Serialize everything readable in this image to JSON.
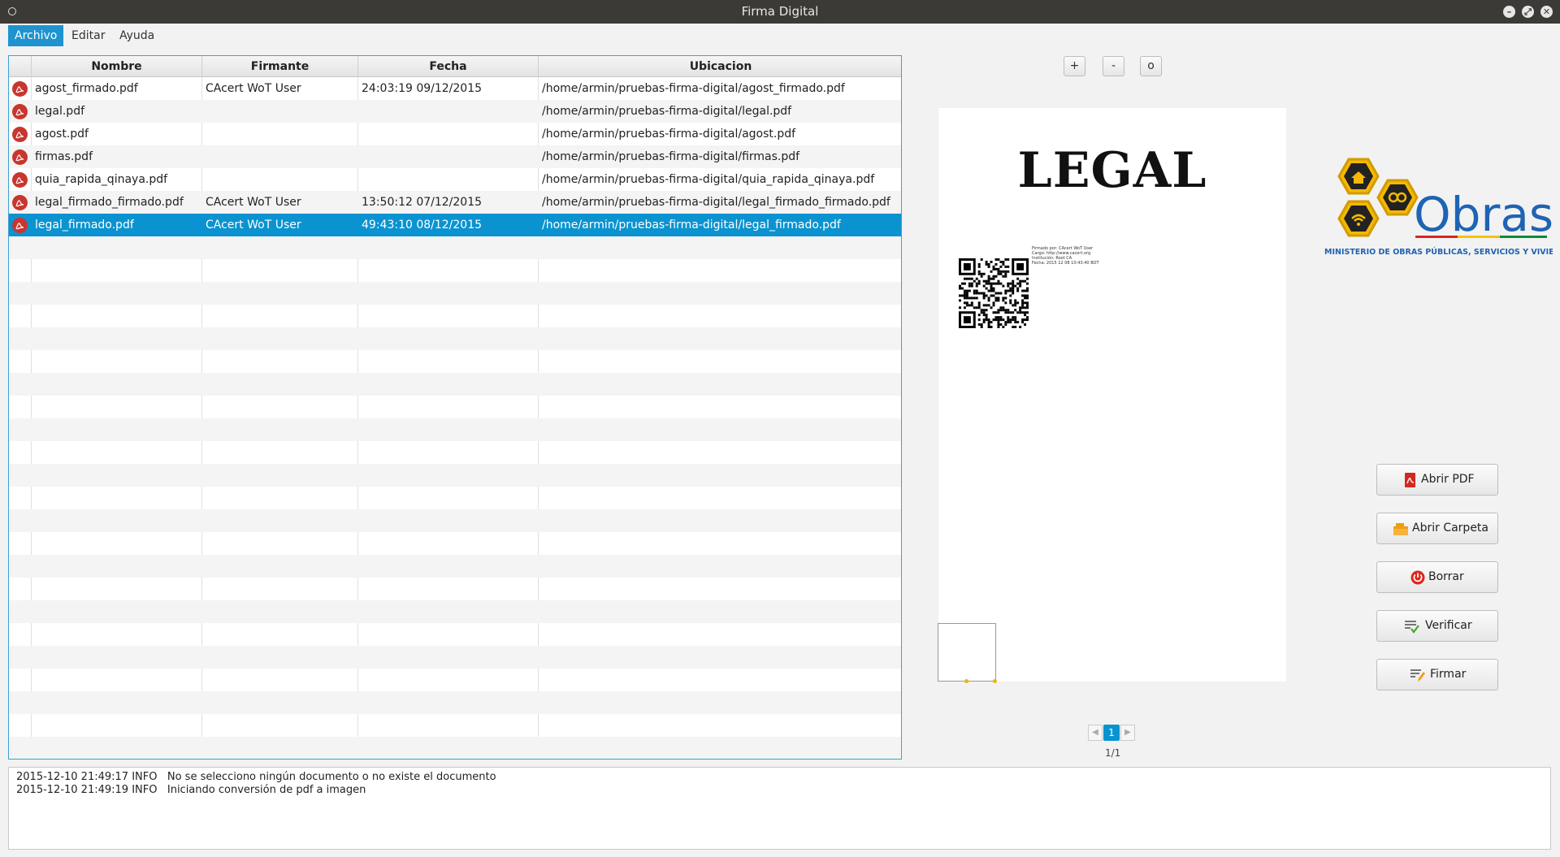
{
  "window": {
    "title": "Firma Digital"
  },
  "menu": [
    {
      "label": "Archivo",
      "active": true
    },
    {
      "label": "Editar",
      "active": false
    },
    {
      "label": "Ayuda",
      "active": false
    }
  ],
  "table": {
    "columns": [
      "Nombre",
      "Firmante",
      "Fecha",
      "Ubicacion"
    ],
    "rows": [
      {
        "nombre": "agost_firmado.pdf",
        "firmante": "CAcert WoT User",
        "fecha": "24:03:19 09/12/2015",
        "ubicacion": "/home/armin/pruebas-firma-digital/agost_firmado.pdf"
      },
      {
        "nombre": "legal.pdf",
        "firmante": "",
        "fecha": "",
        "ubicacion": "/home/armin/pruebas-firma-digital/legal.pdf"
      },
      {
        "nombre": "agost.pdf",
        "firmante": "",
        "fecha": "",
        "ubicacion": "/home/armin/pruebas-firma-digital/agost.pdf"
      },
      {
        "nombre": "firmas.pdf",
        "firmante": "",
        "fecha": "",
        "ubicacion": "/home/armin/pruebas-firma-digital/firmas.pdf"
      },
      {
        "nombre": "quia_rapida_qinaya.pdf",
        "firmante": "",
        "fecha": "",
        "ubicacion": "/home/armin/pruebas-firma-digital/quia_rapida_qinaya.pdf"
      },
      {
        "nombre": "legal_firmado_firmado.pdf",
        "firmante": "CAcert WoT User",
        "fecha": "13:50:12 07/12/2015",
        "ubicacion": "/home/armin/pruebas-firma-digital/legal_firmado_firmado.pdf"
      },
      {
        "nombre": "legal_firmado.pdf",
        "firmante": "CAcert WoT User",
        "fecha": "49:43:10 08/12/2015",
        "ubicacion": "/home/armin/pruebas-firma-digital/legal_firmado.pdf",
        "selected": true
      }
    ],
    "file_icon": "pdf-icon"
  },
  "viewer": {
    "zoom_in": "+",
    "zoom_out": "-",
    "zoom_reset": "o",
    "page_heading": "LEGAL",
    "signature_text": [
      "Firmado por: CAcert WoT User",
      "Cargo: http://www.cacert.org",
      "Institución: Root CA",
      "Fecha: 2015 12 08 10:43:40 BOT"
    ],
    "current_page": "1",
    "page_count": "1/1",
    "prev_icon": "triangle-left-icon",
    "next_icon": "triangle-right-icon"
  },
  "logo": {
    "brand": "Obras",
    "ministry": "MINISTERIO DE OBRAS PÚBLICAS, SERVICIOS Y VIVIENDA"
  },
  "actions": [
    {
      "label": "Abrir PDF",
      "icon": "pdf-file-icon"
    },
    {
      "label": "Abrir Carpeta",
      "icon": "folder-icon"
    },
    {
      "label": "Borrar",
      "icon": "power-icon"
    },
    {
      "label": "Verificar",
      "icon": "checklist-icon"
    },
    {
      "label": "Firmar",
      "icon": "sign-pencil-icon"
    }
  ],
  "log": [
    "2015-12-10 21:49:17 INFO   No se selecciono ningún documento o no existe el documento",
    "2015-12-10 21:49:19 INFO   Iniciando conversión de pdf a imagen"
  ],
  "colors": {
    "accent": "#0a93d0",
    "titlebar": "#3b3a36",
    "pdf_red": "#c8362f"
  }
}
